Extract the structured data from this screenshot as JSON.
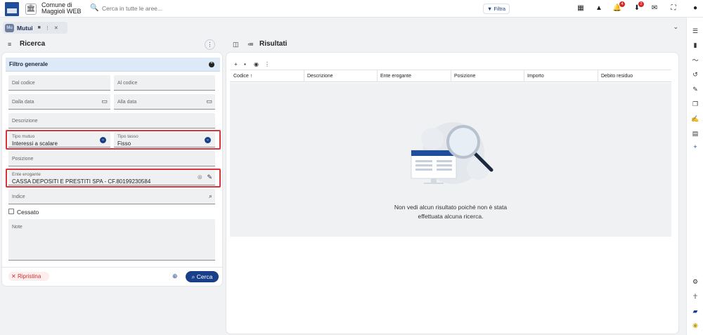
{
  "header": {
    "app_name_line1": "Comune di",
    "app_name_line2": "Maggioli WEB",
    "search_placeholder": "Cerca in tutte le aree...",
    "filter_label": "Filtra",
    "notifications": {
      "bell_count": "4",
      "download_count": "2"
    }
  },
  "tabs": [
    {
      "badge": "Mu",
      "label": "Mutui"
    }
  ],
  "left_panel": {
    "title": "Ricerca",
    "group_title": "Filtro generale",
    "fields": {
      "dal_codice": "Dal codice",
      "al_codice": "Al codice",
      "dalla_data": "Dalla data",
      "alla_data": "Alla data",
      "descrizione": "Descrizione",
      "tipo_mutuo_label": "Tipo mutuo",
      "tipo_mutuo_value": "Interessi a scalare",
      "tipo_tasso_label": "Tipo tasso",
      "tipo_tasso_value": "Fisso",
      "posizione": "Posizione",
      "ente_label": "Ente erogante",
      "ente_value": "CASSA DEPOSITI E PRESTITI SPA - CF.80199230584",
      "indice": "Indice",
      "cessato": "Cessato",
      "note": "Note"
    },
    "reset_label": "Ripristina",
    "search_label": "Cerca"
  },
  "right_panel": {
    "title": "Risultati",
    "columns": [
      "Codice",
      "Descrizione",
      "Ente erogante",
      "Posizione",
      "Importo",
      "Debito residuo"
    ],
    "sort_indicator": "↑",
    "empty_line1": "Non vedi alcun risultato poiché non è stata",
    "empty_line2": "effettuata alcuna ricerca."
  },
  "colors": {
    "accent": "#1a3f8a",
    "highlight": "#d9333b",
    "group_bg": "#dde9f7"
  }
}
